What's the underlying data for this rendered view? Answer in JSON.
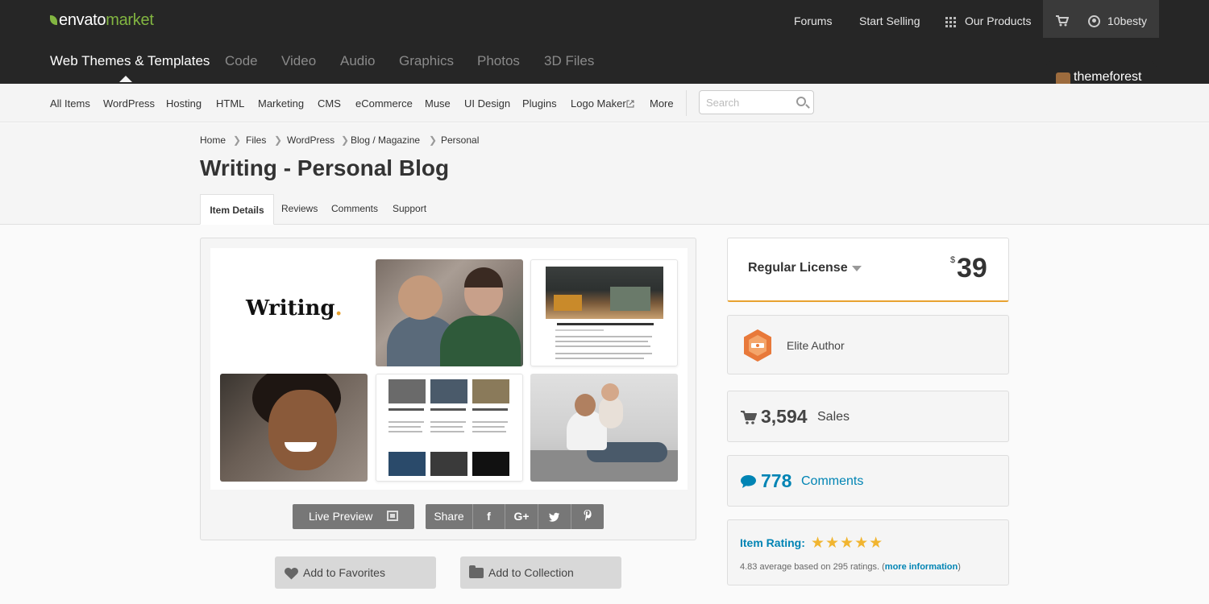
{
  "brand": {
    "envato": "envato",
    "market": "market"
  },
  "top_links": {
    "forums": "Forums",
    "start_selling": "Start Selling",
    "our_products": "Our Products",
    "username": "10besty"
  },
  "categories": [
    "Web Themes & Templates",
    "Code",
    "Video",
    "Audio",
    "Graphics",
    "Photos",
    "3D Files"
  ],
  "marketplace": "themeforest",
  "subnav": [
    "All Items",
    "WordPress",
    "Hosting",
    "HTML",
    "Marketing",
    "CMS",
    "eCommerce",
    "Muse",
    "UI Design",
    "Plugins",
    "Logo Maker",
    "More"
  ],
  "search": {
    "placeholder": "Search"
  },
  "breadcrumb": [
    "Home",
    "Files",
    "WordPress",
    "Blog / Magazine",
    "Personal"
  ],
  "page_title": "Writing - Personal Blog",
  "tabs": [
    "Item Details",
    "Reviews",
    "Comments",
    "Support"
  ],
  "preview": {
    "logo_text": "Writing",
    "logo_dot": ".",
    "live_preview": "Live Preview",
    "share": "Share",
    "share_icons": [
      "f",
      "G+"
    ]
  },
  "actions": {
    "favorites": "Add to Favorites",
    "collection": "Add to Collection"
  },
  "license": {
    "name": "Regular License",
    "currency": "$",
    "price": "39"
  },
  "author": {
    "label": "Elite Author"
  },
  "sales": {
    "count": "3,594",
    "label": "Sales"
  },
  "comments": {
    "count": "778",
    "label": "Comments"
  },
  "rating": {
    "label": "Item Rating:",
    "stars": "★★★★★",
    "average_text": "4.83 average based on 295 ratings. (",
    "more_info": "more information",
    "close_paren": ")"
  },
  "colors": {
    "header": "#262626",
    "accent_green": "#82b541",
    "link_blue": "#0084b4",
    "star": "#f1b530",
    "license_border": "#e8a230"
  }
}
